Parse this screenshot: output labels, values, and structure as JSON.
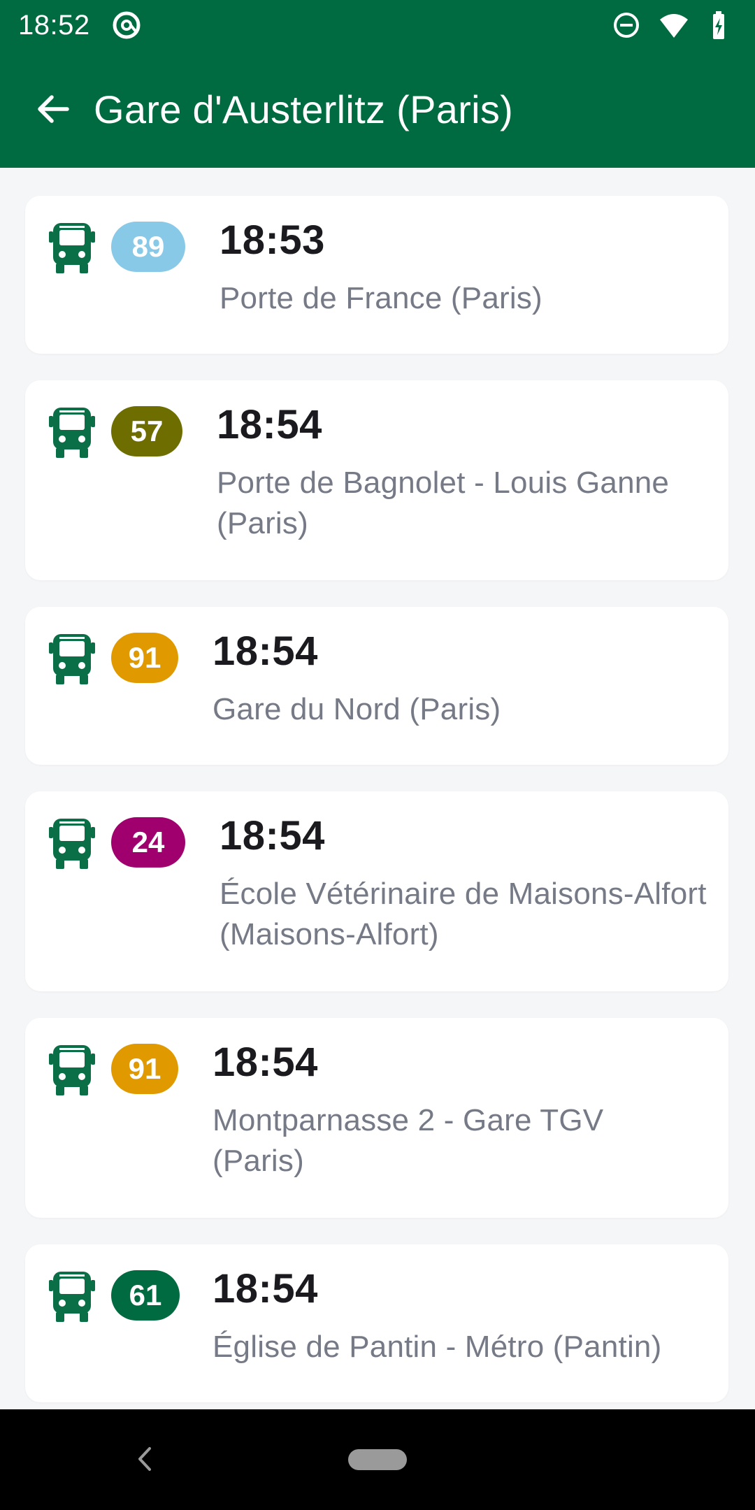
{
  "status_bar": {
    "time": "18:52",
    "icons": [
      "at-sign-icon",
      "do-not-disturb-icon",
      "wifi-icon",
      "battery-charging-icon"
    ]
  },
  "app_bar": {
    "back_icon": "arrow-left-icon",
    "title": "Gare d'Austerlitz (Paris)"
  },
  "colors": {
    "primary": "#006a40",
    "bus_icon": "#0a6e47"
  },
  "departures": [
    {
      "line": "89",
      "line_color": "#87c9e6",
      "time": "18:53",
      "destination": "Porte de France (Paris)"
    },
    {
      "line": "57",
      "line_color": "#6e6e00",
      "time": "18:54",
      "destination": "Porte de Bagnolet - Louis Ganne (Paris)"
    },
    {
      "line": "91",
      "line_color": "#e09a00",
      "time": "18:54",
      "destination": "Gare du Nord (Paris)"
    },
    {
      "line": "24",
      "line_color": "#a0006e",
      "time": "18:54",
      "destination": "École Vétérinaire de Maisons-Alfort (Maisons-Alfort)"
    },
    {
      "line": "91",
      "line_color": "#e09a00",
      "time": "18:54",
      "destination": "Montparnasse 2 - Gare TGV (Paris)"
    },
    {
      "line": "61",
      "line_color": "#006a40",
      "time": "18:54",
      "destination": "Église de Pantin - Métro (Pantin)"
    }
  ],
  "nav_bar": {
    "back_icon": "nav-back-icon",
    "home_icon": "nav-home-pill"
  }
}
